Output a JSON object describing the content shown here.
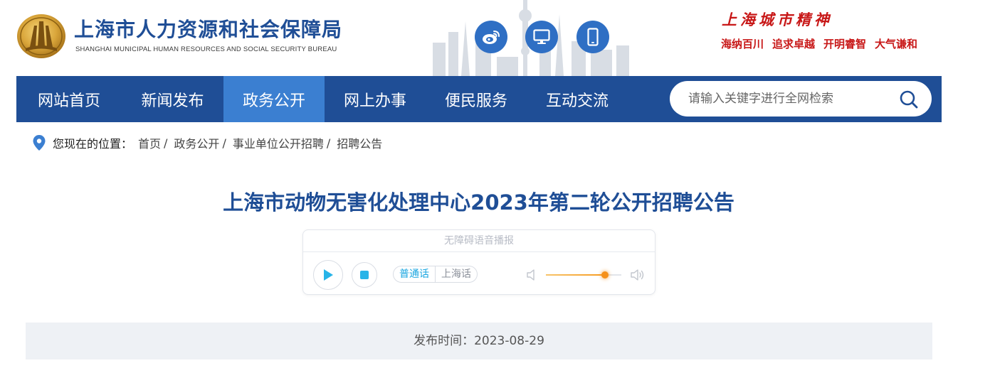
{
  "header": {
    "title": "上海市人力资源和社会保障局",
    "title_en": "SHANGHAI MUNICIPAL HUMAN RESOURCES AND SOCIAL SECURITY BUREAU",
    "social_icons": [
      "weibo-icon",
      "desktop-icon",
      "mobile-icon"
    ],
    "spirit": {
      "title": "上海城市精神",
      "items": [
        "海纳百川",
        "追求卓越",
        "开明睿智",
        "大气谦和"
      ]
    }
  },
  "nav": {
    "items": [
      {
        "label": "网站首页"
      },
      {
        "label": "新闻发布"
      },
      {
        "label": "政务公开"
      },
      {
        "label": "网上办事"
      },
      {
        "label": "便民服务"
      },
      {
        "label": "互动交流"
      }
    ],
    "active": "政务公开",
    "search_placeholder": "请输入关键字进行全网检索"
  },
  "breadcrumb": {
    "label": "您现在的位置：",
    "items": [
      "首页",
      "政务公开",
      "事业单位公开招聘",
      "招聘公告"
    ]
  },
  "article": {
    "title": "上海市动物无害化处理中心2023年第二轮公开招聘公告",
    "publish": "发布时间：2023-08-29"
  },
  "player": {
    "header": "无障碍语音播报",
    "lang_active": "普通话",
    "lang_other": "上海话",
    "volume": 0.78
  },
  "colors": {
    "brand_blue": "#1f4e96",
    "nav_active": "#3b7fd1",
    "spirit_red": "#c81818",
    "player_accent": "#27b4e8",
    "volume_orange": "#f5901a"
  }
}
